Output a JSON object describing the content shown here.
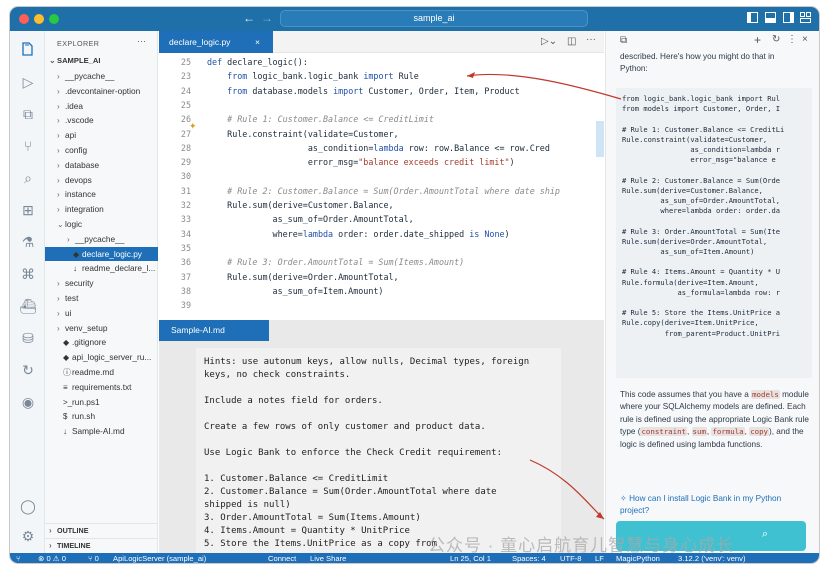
{
  "titlebar": {
    "search_text": "sample_ai",
    "nav_back": "←",
    "nav_forward": "→"
  },
  "explorer": {
    "header": "EXPLORER",
    "more": "···",
    "root": "SAMPLE_AI",
    "items": [
      {
        "label": "__pycache__",
        "chev": "›",
        "icon": ""
      },
      {
        "label": ".devcontainer-option",
        "chev": "›",
        "icon": ""
      },
      {
        "label": ".idea",
        "chev": "›",
        "icon": ""
      },
      {
        "label": ".vscode",
        "chev": "›",
        "icon": ""
      },
      {
        "label": "api",
        "chev": "›",
        "icon": ""
      },
      {
        "label": "config",
        "chev": "›",
        "icon": ""
      },
      {
        "label": "database",
        "chev": "›",
        "icon": ""
      },
      {
        "label": "devops",
        "chev": "›",
        "icon": ""
      },
      {
        "label": "instance",
        "chev": "›",
        "icon": ""
      },
      {
        "label": "integration",
        "chev": "›",
        "icon": ""
      },
      {
        "label": "logic",
        "chev": "⌄",
        "icon": ""
      },
      {
        "label": "__pycache__",
        "chev": "›",
        "icon": ""
      },
      {
        "label": "declare_logic.py",
        "chev": "",
        "icon": "◆"
      },
      {
        "label": "readme_declare_l...",
        "chev": "",
        "icon": "↓"
      },
      {
        "label": "security",
        "chev": "›",
        "icon": ""
      },
      {
        "label": "test",
        "chev": "›",
        "icon": ""
      },
      {
        "label": "ui",
        "chev": "›",
        "icon": ""
      },
      {
        "label": "venv_setup",
        "chev": "›",
        "icon": ""
      },
      {
        "label": ".gitignore",
        "chev": "",
        "icon": "◆"
      },
      {
        "label": "api_logic_server_ru...",
        "chev": "",
        "icon": "◆"
      },
      {
        "label": "readme.md",
        "chev": "",
        "icon": "ⓘ"
      },
      {
        "label": "requirements.txt",
        "chev": "",
        "icon": "≡"
      },
      {
        "label": "run.ps1",
        "chev": "",
        "icon": ">_"
      },
      {
        "label": "run.sh",
        "chev": "",
        "icon": "$"
      },
      {
        "label": "Sample-AI.md",
        "chev": "",
        "icon": "↓"
      }
    ],
    "outline": "OUTLINE",
    "timeline": "TIMELINE"
  },
  "editor": {
    "tab_label": "declare_logic.py",
    "tab_close": "×",
    "line_numbers": [
      "23",
      "24",
      "25",
      "26",
      "27",
      "28",
      "29",
      "30",
      "31",
      "32",
      "33",
      "34",
      "35",
      "36",
      "37",
      "38",
      "39"
    ]
  },
  "code_lines": [
    {
      "n": "25",
      "t": "def declare_logic():"
    },
    {
      "n": "23",
      "t": "    from logic_bank.logic_bank import Rule"
    },
    {
      "n": "24",
      "t": "    from database.models import Customer, Order, Item, Product"
    },
    {
      "n": "25",
      "t": ""
    },
    {
      "n": "26",
      "t": "    # Rule 1: Customer.Balance <= CreditLimit"
    },
    {
      "n": "27",
      "t": "    Rule.constraint(validate=Customer,"
    },
    {
      "n": "28",
      "t": "                    as_condition=lambda row: row.Balance <= row.Cred"
    },
    {
      "n": "29",
      "t": "                    error_msg=\"balance exceeds credit limit\")"
    },
    {
      "n": "30",
      "t": ""
    },
    {
      "n": "31",
      "t": "    # Rule 2: Customer.Balance = Sum(Order.AmountTotal where date ship"
    },
    {
      "n": "32",
      "t": "    Rule.sum(derive=Customer.Balance,"
    },
    {
      "n": "33",
      "t": "             as_sum_of=Order.AmountTotal,"
    },
    {
      "n": "34",
      "t": "             where=lambda order: order.date_shipped is None)"
    },
    {
      "n": "35",
      "t": ""
    },
    {
      "n": "36",
      "t": "    # Rule 3: Order.AmountTotal = Sum(Items.Amount)"
    },
    {
      "n": "37",
      "t": "    Rule.sum(derive=Order.AmountTotal,"
    },
    {
      "n": "38",
      "t": "             as_sum_of=Item.Amount)"
    },
    {
      "n": "39",
      "t": ""
    }
  ],
  "panel": {
    "tab_label": "Sample-AI.md",
    "lines": [
      "Hints: use autonum keys, allow nulls, Decimal types, foreign",
      "keys, no check constraints.",
      "",
      "Include a notes field for orders.",
      "",
      "Create a few rows of only customer and product data.",
      "",
      "Use Logic Bank to enforce the Check Credit requirement:",
      "",
      "1. Customer.Balance <= CreditLimit",
      "2. Customer.Balance = Sum(Order.AmountTotal where date",
      "shipped is null)",
      "3. Order.AmountTotal = Sum(Items.Amount)",
      "4. Items.Amount = Quantity * UnitPrice",
      "5. Store the Items.UnitPrice as a copy from"
    ]
  },
  "chat": {
    "intro_line1": "described. Here's how you might do that in",
    "intro_line2": "Python:",
    "code": "from logic_bank.logic_bank import Rul\nfrom models import Customer, Order, I\n\n# Rule 1: Customer.Balance <= CreditLi\nRule.constraint(validate=Customer,\n                as_condition=lambda r\n                error_msg=\"balance e\n\n# Rule 2: Customer.Balance = Sum(Orde\nRule.sum(derive=Customer.Balance,\n         as_sum_of=Order.AmountTotal,\n         where=lambda order: order.da\n\n# Rule 3: Order.AmountTotal = Sum(Ite\nRule.sum(derive=Order.AmountTotal,\n         as_sum_of=Item.Amount)\n\n# Rule 4: Items.Amount = Quantity * U\nRule.formula(derive=Item.Amount,\n             as_formula=lambda row: r\n\n# Rule 5: Store the Items.UnitPrice a\nRule.copy(derive=Item.UnitPrice,\n          from_parent=Product.UnitPri",
    "explain_a": "This code assumes that you have a",
    "hl_models": "models",
    "explain_b": "module where your SQLAlchemy models are defined. Each rule is defined using the appropriate Logic Bank rule type (",
    "hl_constraint": "constraint",
    "hl_sum": "sum",
    "hl_formula": "formula",
    "hl_copy": "copy",
    "explain_c": "), and the logic is defined using lambda functions.",
    "suggestion": "How can I install Logic Bank in my Python project?"
  },
  "status": {
    "branch": "⑂",
    "errors": "⊗ 0 ⚠ 0",
    "ports": "⑂ 0",
    "server": "ApiLogicServer (sample_ai)",
    "connect": "Connect",
    "liveshare": "Live Share",
    "position": "Ln 25, Col 1",
    "spaces": "Spaces: 4",
    "encoding": "UTF-8",
    "eol": "LF",
    "language": "MagicPython",
    "interpreter": "3.12.2 ('venv': venv)"
  },
  "watermark": "公众号 · 童心启航育儿智慧与身心成长",
  "colors": {
    "accent": "#1e6fb8",
    "titlebar": "#1f6fa8",
    "arrow": "#c0392b",
    "chat_button": "#3fc1d2"
  }
}
